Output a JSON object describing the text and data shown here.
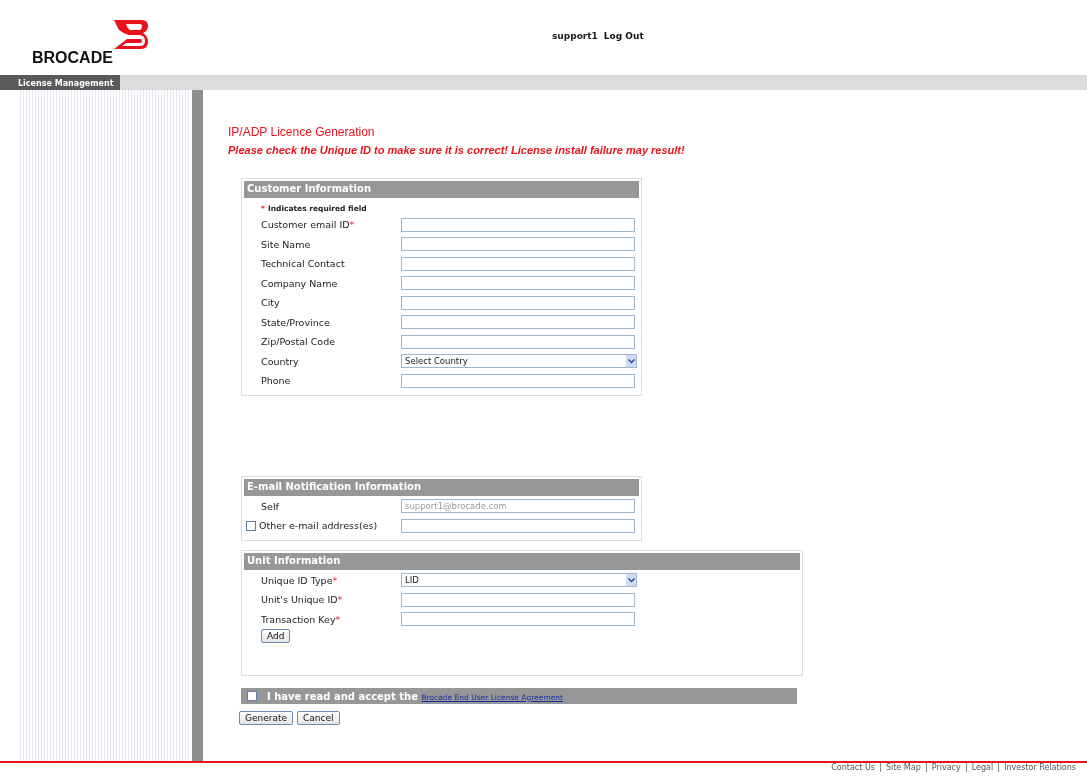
{
  "header": {
    "logo_text": "BROCADE",
    "user": "support1",
    "logout": "Log Out"
  },
  "nav": {
    "tabs": [
      {
        "label": "License Management",
        "selected": true
      }
    ]
  },
  "page_title": "IP/ADP Licence Generation",
  "warning": "Please check the Unique ID to make sure it is correct! License install failure may result!",
  "customer_section": {
    "title": "Customer Information",
    "required_mark": "*",
    "required_note": "Indicates required field",
    "fields": [
      {
        "kind": "text",
        "label": "Customer email ID",
        "mark": "*"
      },
      {
        "kind": "text",
        "label": "Site Name"
      },
      {
        "kind": "text",
        "label": "Technical Contact"
      },
      {
        "kind": "text",
        "label": "Company Name"
      },
      {
        "kind": "text",
        "label": "City"
      },
      {
        "kind": "text",
        "label": "State/Province"
      },
      {
        "kind": "text",
        "label": "Zip/Postal Code"
      },
      {
        "kind": "select",
        "label": "Country",
        "value": "Select Country"
      },
      {
        "kind": "text",
        "label": "Phone"
      }
    ]
  },
  "email_section": {
    "title": "E-mail Notification Information",
    "fields": [
      {
        "kind": "text",
        "label": "Self",
        "placeholder": "support1@brocade.com"
      },
      {
        "kind": "checkbox",
        "label": "Other e-mail address(es)",
        "checked": false
      }
    ]
  },
  "unit_section": {
    "title": "Unit Information",
    "fields": [
      {
        "kind": "select",
        "label": "Unique ID Type",
        "mark": "*",
        "value": "LID"
      },
      {
        "kind": "text",
        "label": "Unit's Unique ID",
        "mark": "*"
      },
      {
        "kind": "text",
        "label": "Transaction Key",
        "mark": "*"
      }
    ],
    "add_button": "Add"
  },
  "agreement": {
    "checked": false,
    "text": "I have read and accept the",
    "link": "Brocade End User License Agreement"
  },
  "buttons": [
    "Generate",
    "Cancel"
  ],
  "footer": {
    "links": [
      "Contact Us",
      "Site Map",
      "Privacy",
      "Legal",
      "Investor Relations"
    ]
  }
}
